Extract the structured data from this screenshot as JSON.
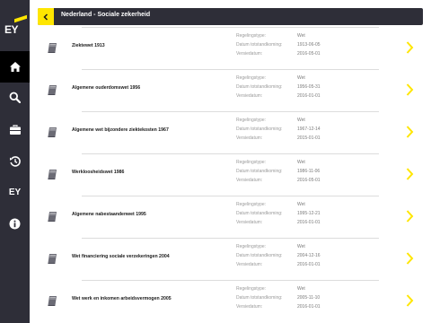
{
  "brand": {
    "logo_text": "EY",
    "accent": "#ffe600",
    "dark": "#2e2e38"
  },
  "sidebar": {
    "items": [
      {
        "icon": "home-icon",
        "active": true
      },
      {
        "icon": "search-icon",
        "active": false
      },
      {
        "icon": "briefcase-icon",
        "active": false
      },
      {
        "icon": "history-icon",
        "active": false
      },
      {
        "icon": "ey-icon",
        "label": "EY",
        "active": false
      },
      {
        "icon": "info-icon",
        "active": false
      }
    ]
  },
  "header": {
    "title": "Nederland - Sociale zekerheid",
    "back_icon": "chevron-left-icon"
  },
  "labels": {
    "type": "Regelingstype:",
    "date": "Datum totstandkoming:",
    "version": "Versiedatum:"
  },
  "laws": [
    {
      "title": "Ziektewet 1913",
      "type": "Wet",
      "date": "1913-06-05",
      "version": "2016-05-01"
    },
    {
      "title": "Algemene ouderdomswet 1956",
      "type": "Wet",
      "date": "1956-05-31",
      "version": "2016-01-01"
    },
    {
      "title": "Algemene wet bijzondere ziektekosten 1967",
      "type": "Wet",
      "date": "1967-12-14",
      "version": "2015-01-01"
    },
    {
      "title": "Werkloosheidswet 1986",
      "type": "Wet",
      "date": "1986-11-06",
      "version": "2016-05-01"
    },
    {
      "title": "Algemene nabestaandenwet 1995",
      "type": "Wet",
      "date": "1995-12-21",
      "version": "2016-01-01"
    },
    {
      "title": "Wet financiering sociale verzekeringen 2004",
      "type": "Wet",
      "date": "2004-12-16",
      "version": "2016-01-01"
    },
    {
      "title": "Wet werk en inkomen arbeidsvermogen 2005",
      "type": "Wet",
      "date": "2005-11-10",
      "version": "2016-01-01"
    }
  ]
}
